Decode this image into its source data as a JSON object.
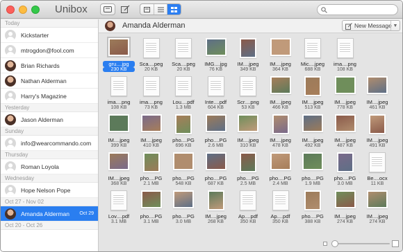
{
  "app": {
    "title": "Unibox"
  },
  "search": {
    "placeholder": "",
    "value": ""
  },
  "sidebar": {
    "sections": [
      {
        "header": "Today",
        "contacts": [
          {
            "name": "Kickstarter",
            "avatar": "default"
          },
          {
            "name": "mtrogdon@fool.com",
            "avatar": "default"
          },
          {
            "name": "Brian Richards",
            "avatar": "photo"
          },
          {
            "name": "Nathan Alderman",
            "avatar": "photo"
          },
          {
            "name": "Harry's Magazine",
            "avatar": "default"
          }
        ]
      },
      {
        "header": "Yesterday",
        "contacts": [
          {
            "name": "Jason Alderman",
            "avatar": "photo"
          }
        ]
      },
      {
        "header": "Sunday",
        "contacts": [
          {
            "name": "info@wearcommando.com",
            "avatar": "default"
          }
        ]
      },
      {
        "header": "Thursday",
        "contacts": [
          {
            "name": "Roman Loyola",
            "avatar": "default"
          }
        ]
      },
      {
        "header": "Wednesday",
        "contacts": [
          {
            "name": "Hope Nelson Pope",
            "avatar": "default"
          }
        ]
      },
      {
        "header": "Oct 27 - Nov 02",
        "contacts": [
          {
            "name": "Amanda Alderman",
            "avatar": "photo",
            "date": "Oct 29",
            "selected": true
          }
        ]
      },
      {
        "header": "Oct 20 - Oct 26",
        "contacts": []
      }
    ]
  },
  "main": {
    "contact_name": "Amanda Alderman",
    "new_message_label": "New Message"
  },
  "files": [
    [
      {
        "name": "gru....jpg",
        "size": "230 KB",
        "kind": "photo",
        "selected": true
      },
      {
        "name": "Sca....peg",
        "size": "20 KB",
        "kind": "doc"
      },
      {
        "name": "Sca....peg",
        "size": "20 KB",
        "kind": "doc"
      },
      {
        "name": "IMG....jpg",
        "size": "76 KB",
        "kind": "photo"
      },
      {
        "name": "IM....jpeg",
        "size": "349 KB",
        "kind": "photo"
      },
      {
        "name": "IM....jpeg",
        "size": "364 KB",
        "kind": "photo"
      },
      {
        "name": "Mic....jpeg",
        "size": "688 KB",
        "kind": "doc"
      },
      {
        "name": "ima....png",
        "size": "108 KB",
        "kind": "doc"
      }
    ],
    [
      {
        "name": "ima....png",
        "size": "108 KB",
        "kind": "doc"
      },
      {
        "name": "ima....png",
        "size": "73 KB",
        "kind": "doc"
      },
      {
        "name": "Lou....pdf",
        "size": "1.3 MB",
        "kind": "doc"
      },
      {
        "name": "Inte....pdf",
        "size": "604 KB",
        "kind": "doc"
      },
      {
        "name": "Scr....png",
        "size": "53 KB",
        "kind": "doc"
      },
      {
        "name": "IM....jpeg",
        "size": "466 KB",
        "kind": "photo"
      },
      {
        "name": "IM....jpeg",
        "size": "513 KB",
        "kind": "photo"
      },
      {
        "name": "IM....jpeg",
        "size": "778 KB",
        "kind": "photo"
      },
      {
        "name": "IM....jpeg",
        "size": "461 KB",
        "kind": "photo"
      }
    ],
    [
      {
        "name": "IM....jpeg",
        "size": "399 KB",
        "kind": "photo"
      },
      {
        "name": "IM....jpeg",
        "size": "410 KB",
        "kind": "photo"
      },
      {
        "name": "pho....PG",
        "size": "696 KB",
        "kind": "photo"
      },
      {
        "name": "pho....PG",
        "size": "2.6 MB",
        "kind": "photo"
      },
      {
        "name": "IM....jpeg",
        "size": "310 KB",
        "kind": "photo"
      },
      {
        "name": "IM....jpeg",
        "size": "478 KB",
        "kind": "photo"
      },
      {
        "name": "IM....jpeg",
        "size": "492 KB",
        "kind": "photo"
      },
      {
        "name": "IM....jpeg",
        "size": "487 KB",
        "kind": "photo"
      },
      {
        "name": "IM....jpeg",
        "size": "491 KB",
        "kind": "photo"
      }
    ],
    [
      {
        "name": "IM....jpeg",
        "size": "368 KB",
        "kind": "photo"
      },
      {
        "name": "pho....PG",
        "size": "2.1 MB",
        "kind": "photo"
      },
      {
        "name": "pho....PG",
        "size": "548 KB",
        "kind": "photo"
      },
      {
        "name": "pho....PG",
        "size": "687 KB",
        "kind": "photo"
      },
      {
        "name": "pho....PG",
        "size": "2.5 MB",
        "kind": "photo"
      },
      {
        "name": "pho....PG",
        "size": "2.4 MB",
        "kind": "photo"
      },
      {
        "name": "pho....PG",
        "size": "1.9 MB",
        "kind": "photo"
      },
      {
        "name": "pho....PG",
        "size": "3.0 MB",
        "kind": "photo"
      },
      {
        "name": "Be....ocx",
        "size": "11 KB",
        "kind": "doc"
      }
    ],
    [
      {
        "name": "Lov....pdf",
        "size": "3.1 MB",
        "kind": "doc"
      },
      {
        "name": "pho....PG",
        "size": "3.1 MB",
        "kind": "photo"
      },
      {
        "name": "pho....PG",
        "size": "3.0 MB",
        "kind": "photo"
      },
      {
        "name": "IM....jpeg",
        "size": "268 KB",
        "kind": "photo"
      },
      {
        "name": "Ap....pdf",
        "size": "350 KB",
        "kind": "doc"
      },
      {
        "name": "Ap....pdf",
        "size": "350 KB",
        "kind": "doc"
      },
      {
        "name": "pho....PG",
        "size": "388 KB",
        "kind": "photo"
      },
      {
        "name": "IM....jpeg",
        "size": "274 KB",
        "kind": "photo"
      },
      {
        "name": "IM....jpeg",
        "size": "274 KB",
        "kind": "photo"
      }
    ]
  ],
  "colors": {
    "accent": "#2a7ef0",
    "sidebar_header_bg": "#f4f4f4",
    "grid_bg": "#e4e4e4"
  },
  "icons": {
    "compose": "compose-icon",
    "archive": "archive-icon",
    "search": "search-icon"
  }
}
